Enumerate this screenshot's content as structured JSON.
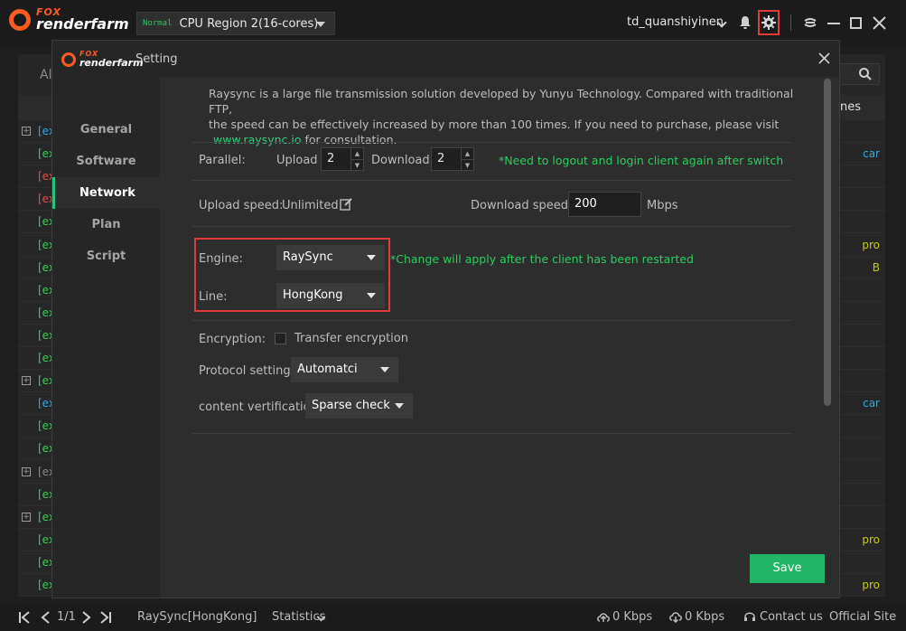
{
  "app": {
    "logo_top": "FOX",
    "logo_bottom": "renderfarm",
    "region_tier": "Normal",
    "region_name": "CPU Region 2(16-cores)",
    "username": "td_quanshiyinen"
  },
  "background": {
    "tab_label": "Al",
    "header_right": "nes",
    "rows": [
      {
        "prefix": "[ex",
        "color": "blue",
        "expandable": true,
        "right": ""
      },
      {
        "prefix": "[ex",
        "color": "green",
        "expandable": false,
        "right": "car"
      },
      {
        "prefix": "[ex",
        "color": "red",
        "expandable": false,
        "right": ""
      },
      {
        "prefix": "[ex",
        "color": "red",
        "expandable": false,
        "right": ""
      },
      {
        "prefix": "[ex",
        "color": "green",
        "expandable": false,
        "right": ""
      },
      {
        "prefix": "[ex",
        "color": "green",
        "expandable": false,
        "right": "pro"
      },
      {
        "prefix": "[ex",
        "color": "green",
        "expandable": false,
        "right": "B"
      },
      {
        "prefix": "[ex",
        "color": "green",
        "expandable": false,
        "right": ""
      },
      {
        "prefix": "[ex",
        "color": "green",
        "expandable": false,
        "right": ""
      },
      {
        "prefix": "[ex",
        "color": "green",
        "expandable": false,
        "right": ""
      },
      {
        "prefix": "[ex",
        "color": "green",
        "expandable": false,
        "right": ""
      },
      {
        "prefix": "[ex",
        "color": "green",
        "expandable": true,
        "right": ""
      },
      {
        "prefix": "[ex",
        "color": "blue",
        "expandable": false,
        "right": "car"
      },
      {
        "prefix": "[ex",
        "color": "green",
        "expandable": false,
        "right": ""
      },
      {
        "prefix": "[ex",
        "color": "green",
        "expandable": false,
        "right": ""
      },
      {
        "prefix": "[ex",
        "color": "grey",
        "expandable": true,
        "right": ""
      },
      {
        "prefix": "[ex",
        "color": "green",
        "expandable": false,
        "right": ""
      },
      {
        "prefix": "[ex",
        "color": "green",
        "expandable": true,
        "right": ""
      },
      {
        "prefix": "[ex",
        "color": "green",
        "expandable": false,
        "right": "pro"
      },
      {
        "prefix": "[ex",
        "color": "green",
        "expandable": false,
        "right": ""
      },
      {
        "prefix": "[ex",
        "color": "green",
        "expandable": false,
        "right": "pro"
      }
    ]
  },
  "statusbar": {
    "page": "1/1",
    "engine_line": "RaySync[HongKong]",
    "statistics": "Statistics",
    "upload_speed": "0 Kbps",
    "download_speed": "0 Kbps",
    "contact": "Contact us",
    "official": "Official Site"
  },
  "dialog": {
    "title": "Setting",
    "sidebar": [
      {
        "label": "General",
        "active": false
      },
      {
        "label": "Software",
        "active": false
      },
      {
        "label": "Network",
        "active": true
      },
      {
        "label": "Plan",
        "active": false
      },
      {
        "label": "Script",
        "active": false
      }
    ],
    "intro_line1": "Raysync is a large file transmission solution developed by Yunyu Technology. Compared with traditional FTP,",
    "intro_line2": "the speed can be effectively increased by more than 100 times. If you need to purchase, please visit",
    "intro_link": "www.raysync.io",
    "intro_suffix": "for consultation.",
    "parallel_label": "Parallel:",
    "upload_label": "Upload",
    "upload_value": "2",
    "download_label": "Download",
    "download_value": "2",
    "parallel_note": "*Need to logout and login client again after switch eng",
    "upload_speed_label": "Upload speed:",
    "upload_speed_value": "Unlimited",
    "download_speed_label": "Download speed:",
    "download_speed_value": "200",
    "download_speed_unit": "Mbps",
    "engine_label": "Engine:",
    "engine_value": "RaySync",
    "engine_note": "*Change will apply after the client has been restarted",
    "line_label": "Line:",
    "line_value": "HongKong",
    "encryption_label": "Encryption:",
    "encryption_option": "Transfer encryption",
    "encryption_checked": false,
    "protocol_label": "Protocol settings",
    "protocol_value": "Automatci",
    "verification_label": "content vertification",
    "verification_value": "Sparse check",
    "save_label": "Save"
  },
  "colors": {
    "accent_green": "#22b567",
    "note_green": "#2ecc5f",
    "highlight_red": "#e23b3b",
    "brand_orange": "#ff5a1f"
  }
}
